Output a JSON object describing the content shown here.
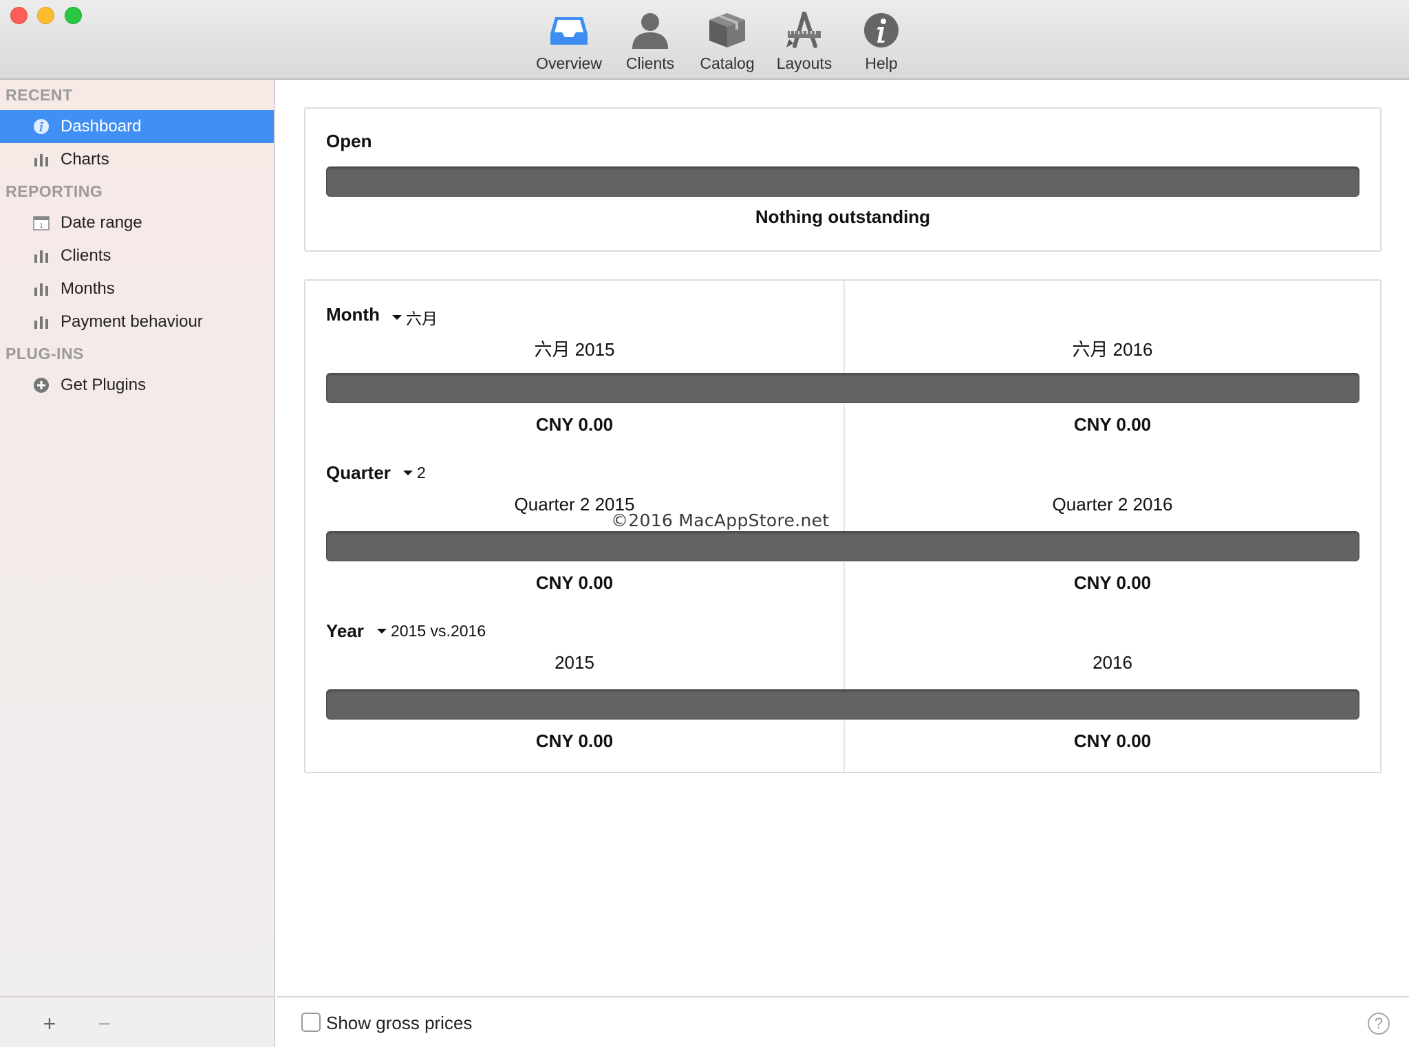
{
  "toolbar": {
    "items": [
      {
        "label": "Overview",
        "icon": "inbox-tray-icon"
      },
      {
        "label": "Clients",
        "icon": "person-icon"
      },
      {
        "label": "Catalog",
        "icon": "package-box-icon"
      },
      {
        "label": "Layouts",
        "icon": "drafting-tools-icon"
      },
      {
        "label": "Help",
        "icon": "info-circle-icon"
      }
    ]
  },
  "sidebar": {
    "sections": [
      {
        "title": "RECENT",
        "items": [
          {
            "label": "Dashboard",
            "icon": "info-circle-icon",
            "selected": true
          },
          {
            "label": "Charts",
            "icon": "bar-chart-icon"
          }
        ]
      },
      {
        "title": "REPORTING",
        "items": [
          {
            "label": "Date range",
            "icon": "calendar-icon"
          },
          {
            "label": "Clients",
            "icon": "bar-chart-icon"
          },
          {
            "label": "Months",
            "icon": "bar-chart-icon"
          },
          {
            "label": "Payment behaviour",
            "icon": "bar-chart-icon"
          }
        ]
      },
      {
        "title": "PLUG-INS",
        "items": [
          {
            "label": "Get Plugins",
            "icon": "plus-circle-icon"
          }
        ]
      }
    ],
    "footer": {
      "add": "+",
      "remove": "−"
    }
  },
  "dashboard": {
    "open": {
      "title": "Open",
      "status": "Nothing outstanding"
    },
    "month": {
      "title": "Month",
      "selector": "六月",
      "left_label": "六月 2015",
      "right_label": "六月 2016",
      "left_amount": "CNY 0.00",
      "right_amount": "CNY 0.00"
    },
    "quarter": {
      "title": "Quarter",
      "selector": "2",
      "left_label": "Quarter 2 2015",
      "right_label": "Quarter 2 2016",
      "left_amount": "CNY 0.00",
      "right_amount": "CNY 0.00"
    },
    "year": {
      "title": "Year",
      "selector": "2015 vs.2016",
      "left_label": "2015",
      "right_label": "2016",
      "left_amount": "CNY 0.00",
      "right_amount": "CNY 0.00"
    },
    "watermark": "©2016 MacAppStore.net"
  },
  "bottombar": {
    "show_gross_label": "Show gross prices",
    "show_gross_checked": false,
    "help": "?"
  },
  "colors": {
    "selection": "#3f8ff4",
    "bar_fill": "#636363",
    "accent_overview": "#3d8ef0"
  }
}
